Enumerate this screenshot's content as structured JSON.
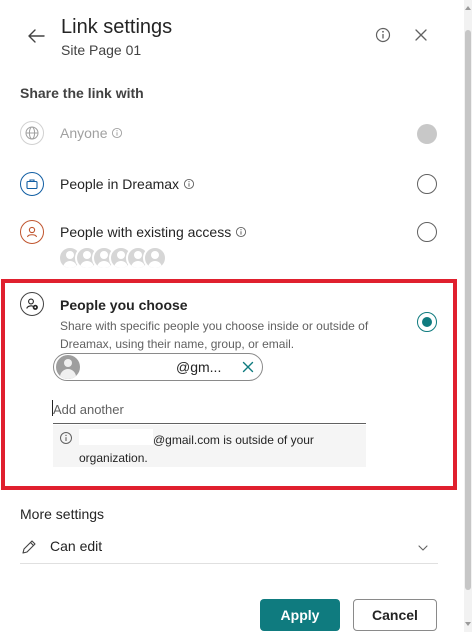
{
  "header": {
    "title": "Link settings",
    "subtitle": "Site Page 01"
  },
  "share_section": {
    "label": "Share the link with",
    "options": [
      {
        "label": "Anyone",
        "state": "disabled"
      },
      {
        "label": "People in Dreamax",
        "state": "unselected"
      },
      {
        "label": "People with existing access",
        "state": "unselected"
      },
      {
        "label": "People you choose",
        "state": "selected",
        "description": "Share with specific people you choose inside or outside of Dreamax, using their name, group, or email."
      }
    ]
  },
  "chosen": {
    "person_text": "@gm...",
    "add_placeholder": "Add another",
    "notice": "@gmail.com is outside of your organization."
  },
  "more_settings": {
    "label": "More settings",
    "permission": "Can edit"
  },
  "footer": {
    "apply_label": "Apply",
    "cancel_label": "Cancel"
  },
  "colors": {
    "accent": "#0f7b7f",
    "highlight_border": "#e0202e"
  }
}
